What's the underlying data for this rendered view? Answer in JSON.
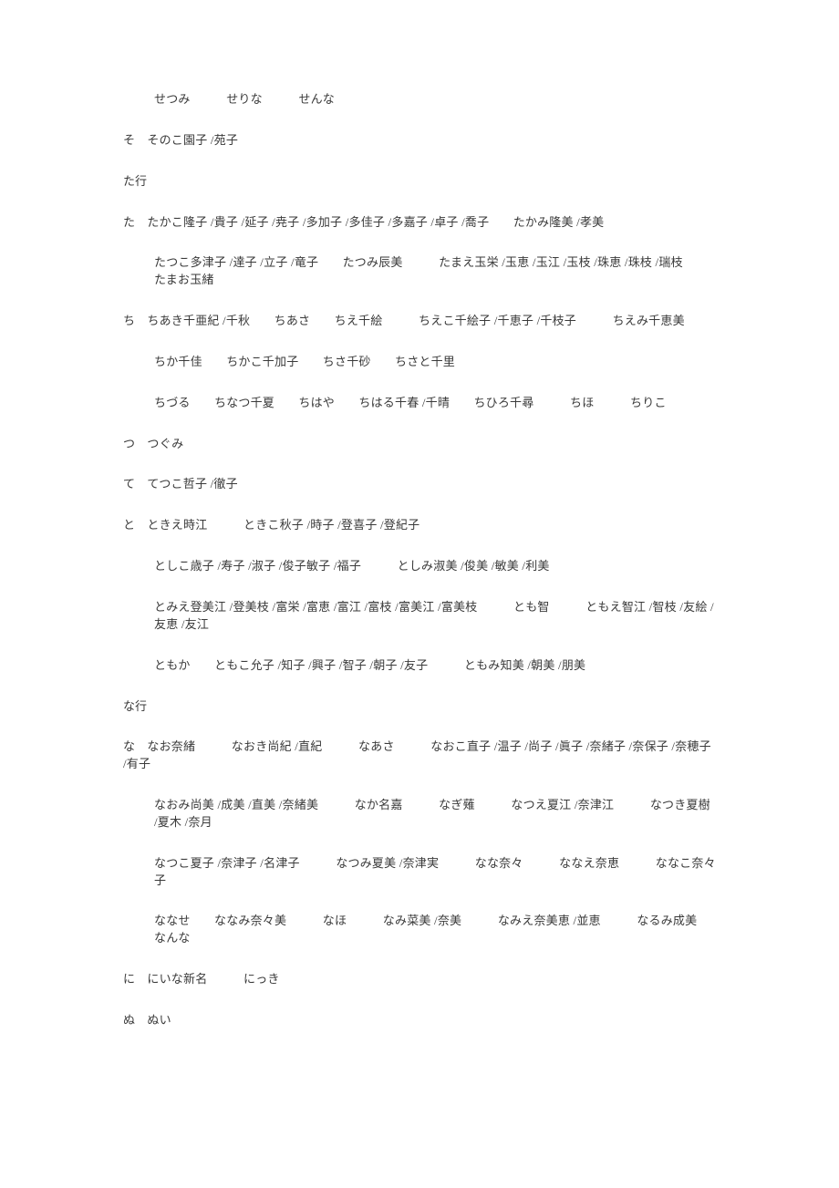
{
  "document": {
    "type": "japanese-given-name-dictionary",
    "page_background": "#ffffff",
    "text_color": "#3a3a3a"
  },
  "blocks": [
    {
      "id": "b0",
      "kind": "entry",
      "indent": 1,
      "text": "せつみ　　　せりな　　　せんな"
    },
    {
      "id": "b1",
      "kind": "entry",
      "indent": 0,
      "text": "そ　そのこ園子 /苑子"
    },
    {
      "id": "b2",
      "kind": "section",
      "indent": 0,
      "text": "た行"
    },
    {
      "id": "b3",
      "kind": "entry",
      "indent": 0,
      "text": "た　たかこ隆子 /貴子 /延子 /尭子 /多加子 /多佳子 /多嘉子 /卓子 /喬子　　たかみ隆美 /孝美"
    },
    {
      "id": "b4",
      "kind": "entry",
      "indent": 1,
      "text": "たつこ多津子 /達子 /立子 /竜子　　たつみ辰美　　　たまえ玉栄 /玉恵 /玉江 /玉枝 /珠恵 /珠枝 /瑞枝　　　たまお玉緒"
    },
    {
      "id": "b5",
      "kind": "entry",
      "indent": 0,
      "text": "ち　ちあき千亜紀 /千秋　　ちあさ　　ちえ千絵　　　ちえこ千絵子 /千恵子 /千枝子　　　ちえみ千恵美"
    },
    {
      "id": "b6",
      "kind": "entry",
      "indent": 1,
      "text": "ちか千佳　　ちかこ千加子　　ちさ千砂　　ちさと千里"
    },
    {
      "id": "b7",
      "kind": "entry",
      "indent": 1,
      "text": "ちづる　　ちなつ千夏　　ちはや　　ちはる千春 /千晴　　ちひろ千尋　　　ちほ　　　ちりこ"
    },
    {
      "id": "b8",
      "kind": "entry",
      "indent": 0,
      "text": "つ　つぐみ"
    },
    {
      "id": "b9",
      "kind": "entry",
      "indent": 0,
      "text": "て　てつこ哲子 /徹子"
    },
    {
      "id": "b10",
      "kind": "entry",
      "indent": 0,
      "text": "と　ときえ時江　　　ときこ秋子 /時子 /登喜子 /登紀子"
    },
    {
      "id": "b11",
      "kind": "entry",
      "indent": 1,
      "text": "としこ歳子 /寿子 /淑子 /俊子敏子 /福子　　　としみ淑美 /俊美 /敏美 /利美"
    },
    {
      "id": "b12",
      "kind": "entry",
      "indent": 1,
      "text": "とみえ登美江 /登美枝 /富栄 /富恵 /富江 /富枝 /富美江 /富美枝　　　とも智　　　ともえ智江 /智枝 /友絵 /友恵 /友江"
    },
    {
      "id": "b13",
      "kind": "entry",
      "indent": 1,
      "text": "ともか　　ともこ允子 /知子 /興子 /智子 /朝子 /友子　　　ともみ知美 /朝美 /朋美"
    },
    {
      "id": "b14",
      "kind": "section",
      "indent": 0,
      "text": "な行"
    },
    {
      "id": "b15",
      "kind": "entry",
      "indent": 0,
      "text": "な　なお奈緒　　　なおき尚紀 /直紀　　　なあさ　　　なおこ直子 /温子 /尚子 /眞子 /奈緒子 /奈保子 /奈穂子 /有子"
    },
    {
      "id": "b16",
      "kind": "entry",
      "indent": 1,
      "text": "なおみ尚美 /成美 /直美 /奈緒美　　　なか名嘉　　　なぎ薙　　　なつえ夏江 /奈津江　　　なつき夏樹 /夏木 /奈月"
    },
    {
      "id": "b17",
      "kind": "entry",
      "indent": 1,
      "text": "なつこ夏子 /奈津子 /名津子　　　なつみ夏美 /奈津実　　　なな奈々　　　ななえ奈恵　　　ななこ奈々子"
    },
    {
      "id": "b18",
      "kind": "entry",
      "indent": 1,
      "text": "ななせ　　ななみ奈々美　　　なほ　　　なみ菜美 /奈美　　　なみえ奈美恵 /並恵　　　なるみ成美　　　なんな"
    },
    {
      "id": "b19",
      "kind": "entry",
      "indent": 0,
      "text": "に　にいな新名　　　にっき"
    },
    {
      "id": "b20",
      "kind": "entry",
      "indent": 0,
      "text": "ぬ　ぬい"
    }
  ]
}
